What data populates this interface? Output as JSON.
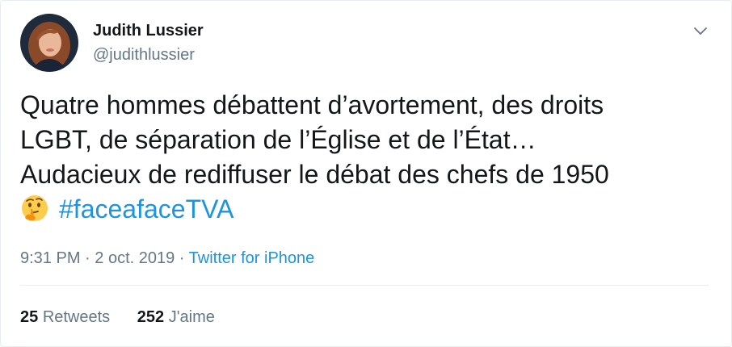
{
  "author": {
    "name": "Judith Lussier",
    "handle": "@judithlussier"
  },
  "tweet": {
    "lines": [
      "Quatre hommes débattent d’avortement, des droits",
      "LGBT, de séparation de l’Église et de l’État…",
      "Audacieux de rediffuser le débat des chefs de 1950"
    ],
    "emoji": "thinking-face-emoji",
    "hashtag": "#faceafaceTVA"
  },
  "meta": {
    "time": "9:31 PM",
    "separator1": " · ",
    "date": "2 oct. 2019",
    "separator2": " · ",
    "source": "Twitter for iPhone"
  },
  "stats": {
    "retweets_count": "25",
    "retweets_label": "Retweets",
    "likes_count": "252",
    "likes_label": "J'aime"
  },
  "colors": {
    "link": "#1b95e0",
    "secondary_text": "#657786",
    "primary_text": "#14171a",
    "divider": "#e6ecf0"
  }
}
